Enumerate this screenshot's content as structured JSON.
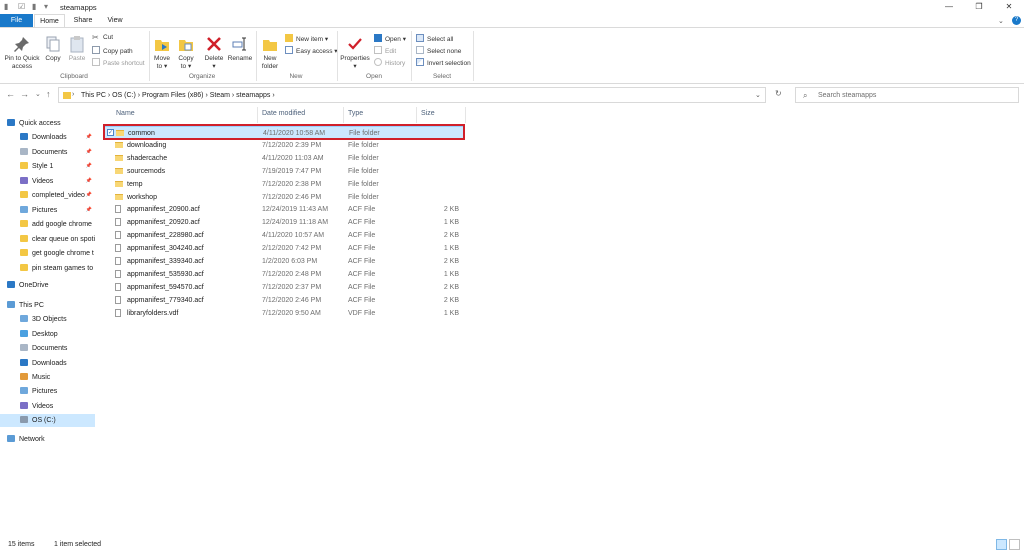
{
  "window": {
    "title": "steamapps",
    "controls": [
      "—",
      "❐",
      "✕"
    ]
  },
  "tabs": [
    "File",
    "Home",
    "Share",
    "View"
  ],
  "ribbon": {
    "clipboard": {
      "pin_line1": "Pin to Quick",
      "pin_line2": "access",
      "copy": "Copy",
      "paste": "Paste",
      "cut": "Cut",
      "copy_path": "Copy path",
      "paste_shortcut": "Paste shortcut",
      "group": "Clipboard"
    },
    "organize": {
      "move_line1": "Move",
      "move_line2": "to ▾",
      "copy_line1": "Copy",
      "copy_line2": "to ▾",
      "delete_line1": "Delete",
      "delete_line2": "▾",
      "rename": "Rename",
      "group": "Organize"
    },
    "new": {
      "folder_line1": "New",
      "folder_line2": "folder",
      "new_item": "New item ▾",
      "easy_access": "Easy access ▾",
      "group": "New"
    },
    "open": {
      "properties_line1": "Properties",
      "properties_line2": "▾",
      "open": "Open ▾",
      "edit": "Edit",
      "history": "History",
      "group": "Open"
    },
    "select": {
      "select_all": "Select all",
      "select_none": "Select none",
      "invert": "Invert selection",
      "group": "Select"
    }
  },
  "nav": {
    "breadcrumbs": "This PC  ›  OS (C:)  ›  Program Files (x86)  ›  Steam  ›  steamapps  ›",
    "search_placeholder": "Search steamapps"
  },
  "sidebar": [
    {
      "label": "Quick access",
      "pinned": false
    },
    {
      "label": "Downloads",
      "pinned": true
    },
    {
      "label": "Documents",
      "pinned": true
    },
    {
      "label": "Style 1",
      "pinned": true
    },
    {
      "label": "Videos",
      "pinned": true
    },
    {
      "label": "completed_video",
      "pinned": true
    },
    {
      "label": "Pictures",
      "pinned": true
    },
    {
      "label": "add google chrome",
      "pinned": false
    },
    {
      "label": "clear queue on spoti",
      "pinned": false
    },
    {
      "label": "get google chrome t",
      "pinned": false
    },
    {
      "label": "pin steam games to",
      "pinned": false
    },
    {
      "label": "OneDrive",
      "pinned": false
    },
    {
      "label": "This PC",
      "pinned": false
    },
    {
      "label": "3D Objects",
      "pinned": false
    },
    {
      "label": "Desktop",
      "pinned": false
    },
    {
      "label": "Documents",
      "pinned": false
    },
    {
      "label": "Downloads",
      "pinned": false
    },
    {
      "label": "Music",
      "pinned": false
    },
    {
      "label": "Pictures",
      "pinned": false
    },
    {
      "label": "Videos",
      "pinned": false
    },
    {
      "label": "OS (C:)",
      "pinned": false
    },
    {
      "label": "Network",
      "pinned": false
    }
  ],
  "columns": [
    "Name",
    "Date modified",
    "Type",
    "Size"
  ],
  "files": [
    {
      "name": "common",
      "date": "4/11/2020 10:58 AM",
      "type": "File folder",
      "size": ""
    },
    {
      "name": "downloading",
      "date": "7/12/2020 2:39 PM",
      "type": "File folder",
      "size": ""
    },
    {
      "name": "shadercache",
      "date": "4/11/2020 11:03 AM",
      "type": "File folder",
      "size": ""
    },
    {
      "name": "sourcemods",
      "date": "7/19/2019 7:47 PM",
      "type": "File folder",
      "size": ""
    },
    {
      "name": "temp",
      "date": "7/12/2020 2:38 PM",
      "type": "File folder",
      "size": ""
    },
    {
      "name": "workshop",
      "date": "7/12/2020 2:46 PM",
      "type": "File folder",
      "size": ""
    },
    {
      "name": "appmanifest_20900.acf",
      "date": "12/24/2019 11:43 AM",
      "type": "ACF File",
      "size": "2 KB"
    },
    {
      "name": "appmanifest_20920.acf",
      "date": "12/24/2019 11:18 AM",
      "type": "ACF File",
      "size": "1 KB"
    },
    {
      "name": "appmanifest_228980.acf",
      "date": "4/11/2020 10:57 AM",
      "type": "ACF File",
      "size": "2 KB"
    },
    {
      "name": "appmanifest_304240.acf",
      "date": "2/12/2020 7:42 PM",
      "type": "ACF File",
      "size": "1 KB"
    },
    {
      "name": "appmanifest_339340.acf",
      "date": "1/2/2020 6:03 PM",
      "type": "ACF File",
      "size": "2 KB"
    },
    {
      "name": "appmanifest_535930.acf",
      "date": "7/12/2020 2:48 PM",
      "type": "ACF File",
      "size": "1 KB"
    },
    {
      "name": "appmanifest_594570.acf",
      "date": "7/12/2020 2:37 PM",
      "type": "ACF File",
      "size": "2 KB"
    },
    {
      "name": "appmanifest_779340.acf",
      "date": "7/12/2020 2:46 PM",
      "type": "ACF File",
      "size": "2 KB"
    },
    {
      "name": "libraryfolders.vdf",
      "date": "7/12/2020 9:50 AM",
      "type": "VDF File",
      "size": "1 KB"
    }
  ],
  "status": {
    "items": "15 items",
    "selected": "1 item selected"
  },
  "colors": {
    "accent": "#1979ca",
    "selection": "#cce8ff",
    "highlight_box": "#d0202a",
    "folder": "#f8d775"
  }
}
